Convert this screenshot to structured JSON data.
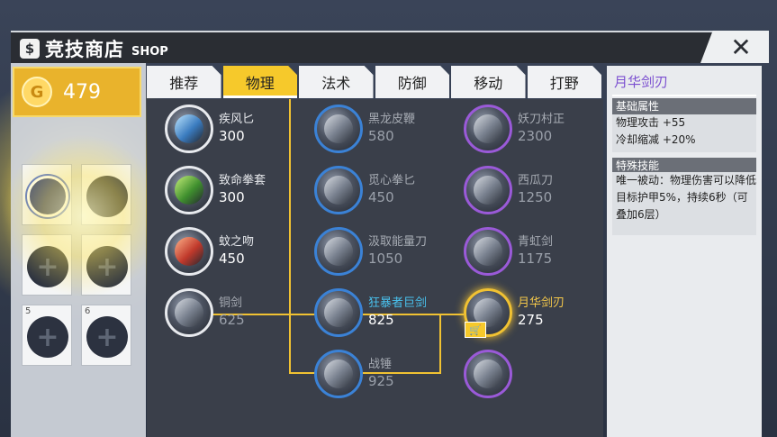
{
  "header": {
    "icon": "money-bag-icon",
    "title": "竞技商店",
    "title_en": "SHOP",
    "close_icon": "close-icon"
  },
  "currency": {
    "icon": "gold-coin-icon",
    "icon_letter": "G",
    "amount": "479"
  },
  "slots": [
    {
      "number": "",
      "state": "active"
    },
    {
      "number": "",
      "state": "empty"
    },
    {
      "number": "",
      "state": "empty"
    },
    {
      "number": "",
      "state": "empty"
    },
    {
      "number": "5",
      "state": "empty"
    },
    {
      "number": "6",
      "state": "empty"
    }
  ],
  "tabs": [
    {
      "label": "推荐"
    },
    {
      "label": "物理",
      "active": true
    },
    {
      "label": "法术"
    },
    {
      "label": "防御"
    },
    {
      "label": "移动"
    },
    {
      "label": "打野"
    }
  ],
  "items": {
    "col1": [
      {
        "name": "疾风匕",
        "price": "300"
      },
      {
        "name": "致命拳套",
        "price": "300"
      },
      {
        "name": "蚊之吻",
        "price": "450"
      },
      {
        "name": "铜剑",
        "price": "625"
      }
    ],
    "col2": [
      {
        "name": "黑龙皮鞭",
        "price": "580"
      },
      {
        "name": "觅心拳匕",
        "price": "450"
      },
      {
        "name": "汲取能量刀",
        "price": "1050"
      },
      {
        "name": "狂暴者巨剑",
        "price": "825"
      },
      {
        "name": "战锤",
        "price": "925"
      }
    ],
    "col3": [
      {
        "name": "妖刀村正",
        "price": "2300"
      },
      {
        "name": "西瓜刀",
        "price": "1250"
      },
      {
        "name": "青虹剑",
        "price": "1175"
      },
      {
        "name": "月华剑刃",
        "price": "275"
      }
    ]
  },
  "detail": {
    "title": "月华剑刃",
    "basic_header": "基础属性",
    "stats": [
      "物理攻击 +55",
      "冷却缩减 +20%"
    ],
    "skill_header": "特殊技能",
    "skill_text": "唯一被动：物理伤害可以降低目标护甲5%，持续6秒（可叠加6层）"
  }
}
